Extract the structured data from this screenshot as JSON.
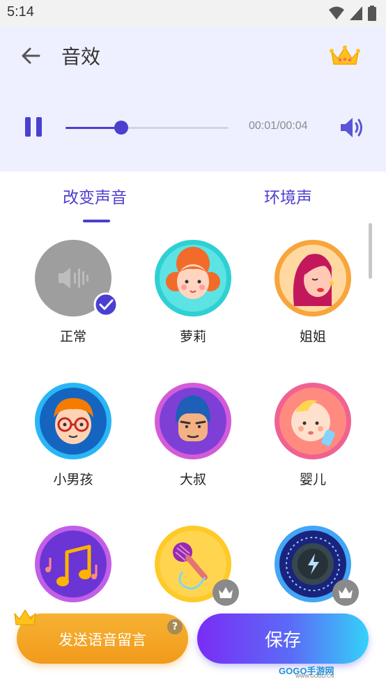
{
  "status_bar": {
    "time": "5:14"
  },
  "header": {
    "title": "音效"
  },
  "player": {
    "time_display": "00:01/00:04",
    "progress": 0.34
  },
  "tabs": [
    {
      "label": "改变声音",
      "active": true
    },
    {
      "label": "环境声",
      "active": false
    }
  ],
  "effects": [
    {
      "name": "正常",
      "icon": "speaker-wave-icon",
      "selected": true,
      "vip": false
    },
    {
      "name": "萝莉",
      "icon": "little-girl-avatar",
      "selected": false,
      "vip": false
    },
    {
      "name": "姐姐",
      "icon": "big-sister-avatar",
      "selected": false,
      "vip": false
    },
    {
      "name": "小男孩",
      "icon": "little-boy-avatar",
      "selected": false,
      "vip": false
    },
    {
      "name": "大叔",
      "icon": "uncle-avatar",
      "selected": false,
      "vip": false
    },
    {
      "name": "婴儿",
      "icon": "baby-avatar",
      "selected": false,
      "vip": false
    },
    {
      "name": "",
      "icon": "music-note-icon",
      "selected": false,
      "vip": false
    },
    {
      "name": "",
      "icon": "microphone-icon",
      "selected": false,
      "vip": true
    },
    {
      "name": "",
      "icon": "lightning-knob-icon",
      "selected": false,
      "vip": true
    }
  ],
  "bottom": {
    "send_voice_message_label": "发送语音留言",
    "help_badge": "?",
    "save_label": "保存"
  },
  "watermark": {
    "brand": "GOGO手游网",
    "url": "WWW.GOGO.CN"
  },
  "colors": {
    "accent": "#4b3fd0",
    "header_bg": "#eef0ff",
    "orange": "#f29a1b"
  }
}
